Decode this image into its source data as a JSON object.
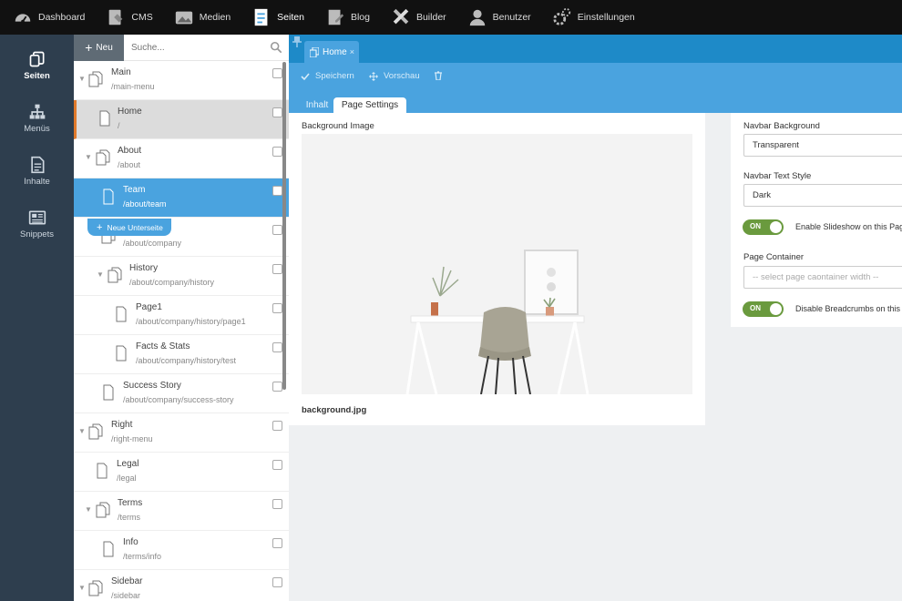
{
  "top_nav": {
    "items": [
      {
        "label": "Dashboard",
        "icon": "speedometer-icon"
      },
      {
        "label": "CMS",
        "icon": "cms-icon"
      },
      {
        "label": "Medien",
        "icon": "media-icon"
      },
      {
        "label": "Seiten",
        "icon": "pages-icon",
        "active": true
      },
      {
        "label": "Blog",
        "icon": "blog-icon"
      },
      {
        "label": "Builder",
        "icon": "tools-icon"
      },
      {
        "label": "Benutzer",
        "icon": "user-icon"
      },
      {
        "label": "Einstellungen",
        "icon": "gears-icon"
      }
    ]
  },
  "sidebar": {
    "items": [
      {
        "label": "Seiten",
        "icon": "pages-icon",
        "active": true
      },
      {
        "label": "Menüs",
        "icon": "sitemap-icon"
      },
      {
        "label": "Inhalte",
        "icon": "document-icon"
      },
      {
        "label": "Snippets",
        "icon": "newspaper-icon"
      }
    ]
  },
  "tree": {
    "new_label": "Neu",
    "search_placeholder": "Suche...",
    "new_subpage_label": "Neue Unterseite",
    "rows": [
      {
        "title": "Main",
        "path": "/main-menu"
      },
      {
        "title": "Home",
        "path": "/"
      },
      {
        "title": "About",
        "path": "/about"
      },
      {
        "title": "Team",
        "path": "/about/team"
      },
      {
        "title": "",
        "path": "/about/company"
      },
      {
        "title": "History",
        "path": "/about/company/history"
      },
      {
        "title": "Page1",
        "path": "/about/company/history/page1"
      },
      {
        "title": "Facts & Stats",
        "path": "/about/company/history/test"
      },
      {
        "title": "Success Story",
        "path": "/about/company/success-story"
      },
      {
        "title": "Right",
        "path": "/right-menu"
      },
      {
        "title": "Legal",
        "path": "/legal"
      },
      {
        "title": "Terms",
        "path": "/terms"
      },
      {
        "title": "Info",
        "path": "/terms/info"
      },
      {
        "title": "Sidebar",
        "path": "/sidebar"
      }
    ]
  },
  "editor": {
    "tab_label": "Home",
    "tab_close": "×",
    "save_label": "Speichern",
    "preview_label": "Vorschau",
    "subtabs": [
      "Inhalt",
      "Page Settings"
    ],
    "background_image_label": "Background Image",
    "background_image_file": "background.jpg",
    "navbar_background_label": "Navbar Background",
    "navbar_background_value": "Transparent",
    "navbar_text_style_label": "Navbar Text Style",
    "navbar_text_style_value": "Dark",
    "slideshow_toggle_label": "Enable Slideshow on this Page",
    "toggle_on_text": "ON",
    "page_container_label": "Page Container",
    "page_container_placeholder": "-- select page caontainer width --",
    "breadcrumbs_toggle_label": "Disable Breadcrumbs on this Page"
  },
  "colors": {
    "accent": "#4aa3df",
    "dark_blue": "#1e8ac8",
    "topbar": "#111111",
    "sidebar": "#2e3e4e",
    "toggle_on": "#6a9a3e",
    "selected_marker": "#e07a2b"
  }
}
